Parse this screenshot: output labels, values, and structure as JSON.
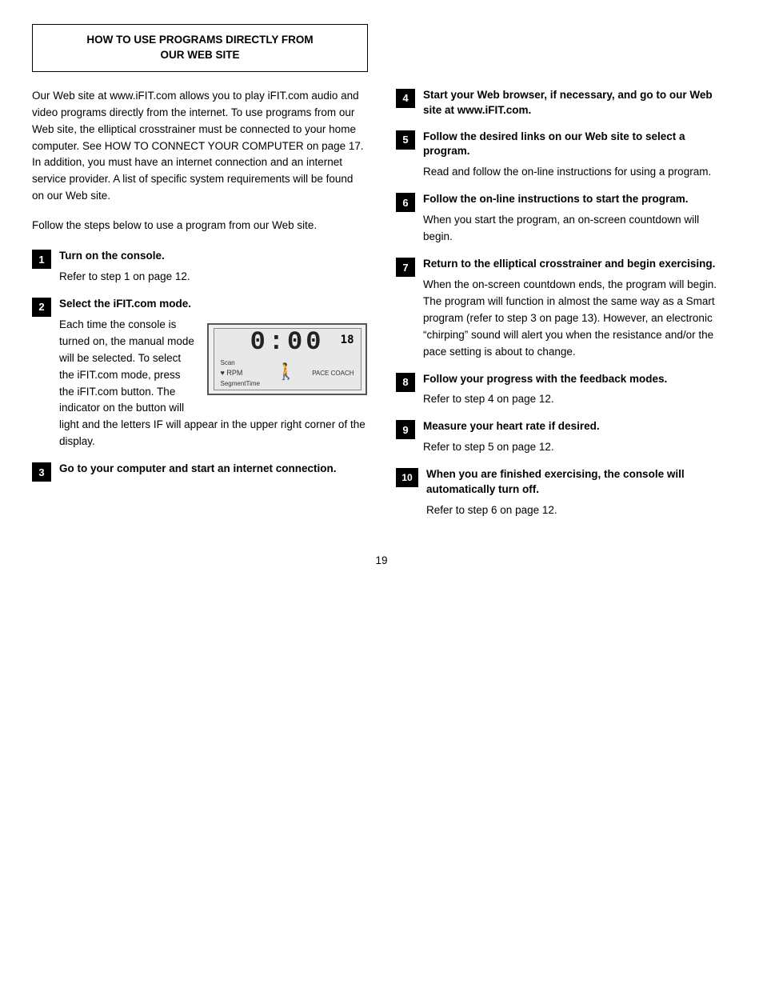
{
  "header": {
    "title_line1": "HOW TO USE PROGRAMS DIRECTLY FROM",
    "title_line2": "OUR WEB SITE"
  },
  "left_col": {
    "intro": "Our Web site at www.iFIT.com allows you to play iFIT.com audio and video programs directly from the internet. To use programs from our Web site, the elliptical crosstrainer must be connected to your home computer. See HOW TO CONNECT YOUR COMPUTER on page 17. In addition, you must have an internet connection and an internet service provider. A list of specific system requirements will be found on our Web site.",
    "follow_steps": "Follow the steps below to use a program from our Web site.",
    "steps": [
      {
        "number": "1",
        "title": "Turn on the console.",
        "body": "Refer to step 1 on page 12."
      },
      {
        "number": "2",
        "title": "Select the iFIT.com mode.",
        "body": "Each time the console is turned on, the manual mode will be selected. To select the iFIT.com mode, press the iFIT.com button. The indicator on the button will light and the letters IF will appear in the upper right corner of the display."
      },
      {
        "number": "3",
        "title": "Go to your computer and start an internet connection.",
        "body": ""
      }
    ]
  },
  "right_col": {
    "steps": [
      {
        "number": "4",
        "title": "Start your Web browser, if necessary, and go to our Web site at www.iFIT.com.",
        "body": ""
      },
      {
        "number": "5",
        "title": "Follow the desired links on our Web site to select a program.",
        "body": "Read and follow the on-line instructions for using a program."
      },
      {
        "number": "6",
        "title": "Follow the on-line instructions to start the program.",
        "body": "When you start the program, an on-screen countdown will begin."
      },
      {
        "number": "7",
        "title": "Return to the elliptical crosstrainer and begin exercising.",
        "body": "When the on-screen countdown ends, the program will begin. The program will function in almost the same way as a Smart program (refer to step 3 on page 13). However, an electronic “chirping” sound will alert you when the resistance and/or the pace setting is about to change."
      },
      {
        "number": "8",
        "title": "Follow your progress with the feedback modes.",
        "body": "Refer to step 4 on page 12."
      },
      {
        "number": "9",
        "title": "Measure your heart rate if desired.",
        "body": "Refer to step 5 on page 12."
      },
      {
        "number": "10",
        "title": "When you are finished exercising, the console will automatically turn off.",
        "body": "Refer to step 6 on page 12."
      }
    ]
  },
  "display": {
    "digits": "0:00",
    "corner": "18",
    "scan_label": "Scan",
    "rpm_label": "♥ RPM",
    "segment_label": "SegmentTime",
    "pace_label": "PACE COACH"
  },
  "page_number": "19"
}
